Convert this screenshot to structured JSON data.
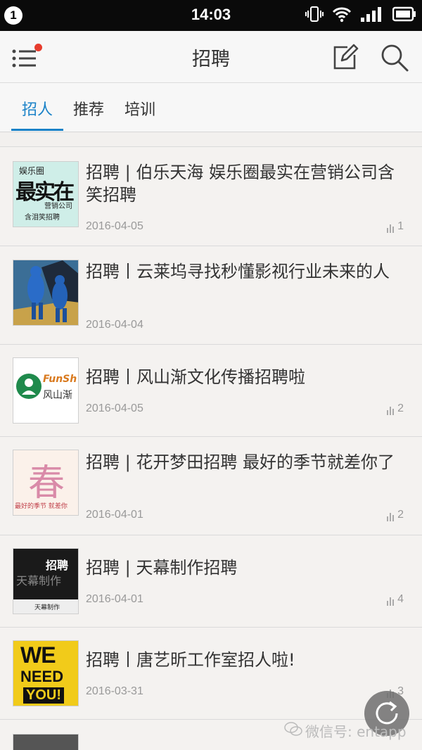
{
  "status_bar": {
    "notification_count": "1",
    "time": "14:03"
  },
  "header": {
    "title": "招聘"
  },
  "tabs": [
    {
      "label": "招人",
      "active": true
    },
    {
      "label": "推荐",
      "active": false
    },
    {
      "label": "培训",
      "active": false
    }
  ],
  "articles": [
    {
      "title": "招聘 | 伯乐天海 娱乐圈最实在营销公司含笑招聘",
      "date": "2016-04-05",
      "views": "1"
    },
    {
      "title": "招聘丨云莱坞寻找秒懂影视行业未来的人",
      "date": "2016-04-04",
      "views": ""
    },
    {
      "title": "招聘丨风山渐文化传播招聘啦",
      "date": "2016-04-05",
      "views": "2"
    },
    {
      "title": "招聘 | 花开梦田招聘 最好的季节就差你了",
      "date": "2016-04-01",
      "views": "2"
    },
    {
      "title": "招聘 | 天幕制作招聘",
      "date": "2016-04-01",
      "views": "4"
    },
    {
      "title": "招聘丨唐艺昕工作室招人啦!",
      "date": "2016-03-31",
      "views": "3"
    }
  ],
  "thumbnails": {
    "t1_line1": "娱乐圈",
    "t1_line2": "最实在",
    "t1_line3": "营销公司",
    "t1_line4": "含泪笑招聘",
    "t3_brand": "FunSh",
    "t3_name": "风山渐",
    "t4_char": "春",
    "t4_caption": "最好的季节 就差你",
    "t5_top": "招聘",
    "t5_mid": "天幕制作",
    "t5_bottom": "天幕制作",
    "t6_line1": "WE",
    "t6_line2": "NEED",
    "t6_line3": "YOU!"
  },
  "watermark": {
    "text": "微信号: entapp"
  },
  "colors": {
    "accent": "#1a82c8",
    "notification_dot": "#e73c2d"
  }
}
